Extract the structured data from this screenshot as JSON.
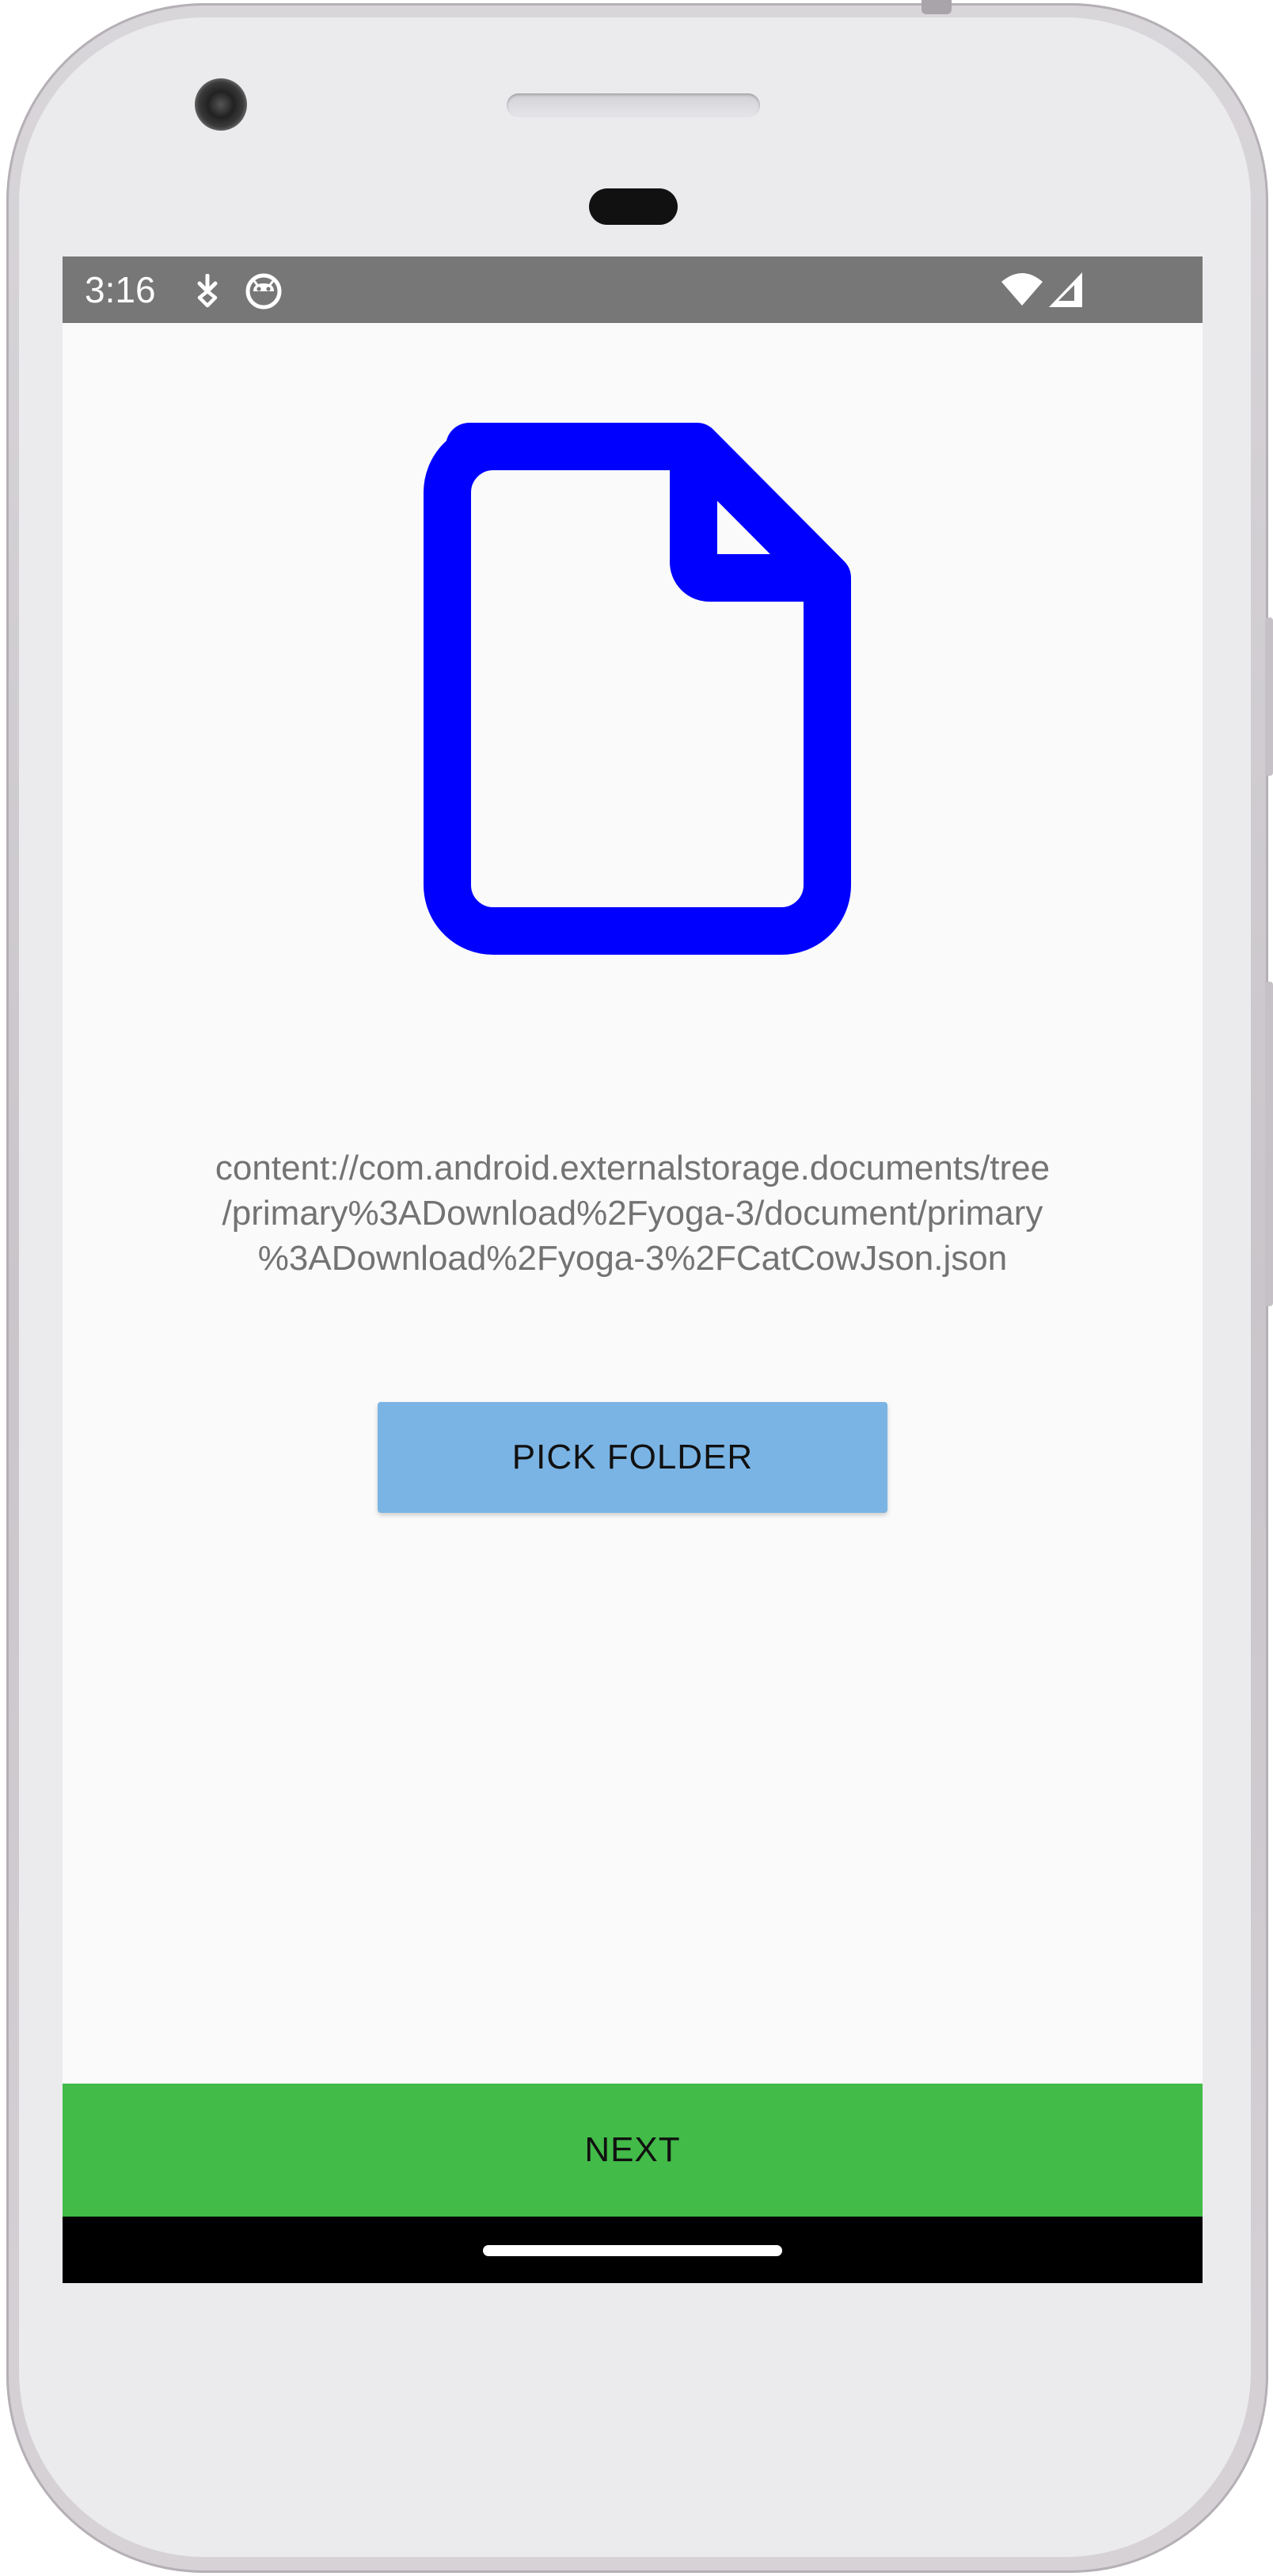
{
  "status_bar": {
    "time": "3:16",
    "left_icons": [
      "download-icon",
      "android-face-icon"
    ],
    "right_icons": [
      "wifi-icon",
      "signal-icon"
    ],
    "background_color": "#777777"
  },
  "main": {
    "icon": "document-icon",
    "icon_color": "#0000ff",
    "uri_text": "content://com.android.externalstorage.documents/tree\n/primary%3ADownload%2Fyoga-3/document/primary\n%3ADownload%2Fyoga-3%2FCatCowJson.json",
    "pick_folder_label": "PICK FOLDER",
    "pick_folder_color": "#7ab4e4"
  },
  "footer": {
    "next_label": "NEXT",
    "next_color": "#42bb48"
  }
}
